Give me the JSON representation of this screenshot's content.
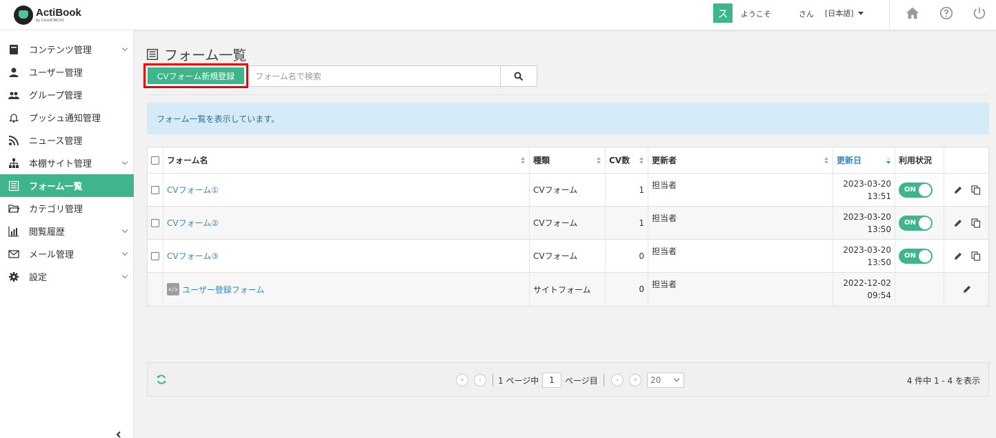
{
  "header": {
    "logo_name": "ActiBook",
    "logo_sub": "by CloudCIRCUS",
    "user_initial": "ス",
    "welcome": "ようこそ",
    "san": "さん",
    "language": "[日本語]",
    "accent_color": "#3fb58c"
  },
  "sidebar": {
    "items": [
      {
        "label": "コンテンツ管理",
        "icon": "book-icon",
        "has_sub": true
      },
      {
        "label": "ユーザー管理",
        "icon": "user-icon",
        "has_sub": false
      },
      {
        "label": "グループ管理",
        "icon": "group-icon",
        "has_sub": false
      },
      {
        "label": "プッシュ通知管理",
        "icon": "bell-icon",
        "has_sub": false
      },
      {
        "label": "ニュース管理",
        "icon": "rss-icon",
        "has_sub": false
      },
      {
        "label": "本棚サイト管理",
        "icon": "sitemap-icon",
        "has_sub": true
      },
      {
        "label": "フォーム一覧",
        "icon": "form-icon",
        "has_sub": false,
        "active": true
      },
      {
        "label": "カテゴリ管理",
        "icon": "folder-icon",
        "has_sub": false
      },
      {
        "label": "閲覧履歴",
        "icon": "chart-icon",
        "has_sub": true
      },
      {
        "label": "メール管理",
        "icon": "mail-icon",
        "has_sub": true
      },
      {
        "label": "設定",
        "icon": "gear-icon",
        "has_sub": true
      }
    ]
  },
  "main": {
    "title": "フォーム一覧",
    "new_button": "CVフォーム新規登録",
    "search_placeholder": "フォーム名で検索",
    "search_value": "",
    "info": "フォーム一覧を表示しています。",
    "columns": [
      "フォーム名",
      "種類",
      "CV数",
      "更新者",
      "更新日",
      "利用状況"
    ],
    "rows": [
      {
        "name": "CVフォーム①",
        "type": "CVフォーム",
        "cv": "1",
        "updater": "担当者",
        "date": "2023-03-20",
        "time": "13:51",
        "status": "ON",
        "site": false
      },
      {
        "name": "CVフォーム②",
        "type": "CVフォーム",
        "cv": "1",
        "updater": "担当者",
        "date": "2023-03-20",
        "time": "13:50",
        "status": "ON",
        "site": false
      },
      {
        "name": "CVフォーム③",
        "type": "CVフォーム",
        "cv": "0",
        "updater": "担当者",
        "date": "2023-03-20",
        "time": "13:50",
        "status": "ON",
        "site": false
      },
      {
        "name": "ユーザー登録フォーム",
        "type": "サイトフォーム",
        "cv": "0",
        "updater": "担当者",
        "date": "2022-12-02",
        "time": "09:54",
        "status": "",
        "site": true
      }
    ]
  },
  "pager": {
    "page_prefix": "1 ページ中",
    "current_page": "1",
    "page_suffix": "ページ目",
    "page_size": "20",
    "count": "4 件中 1 - 4 を表示"
  }
}
